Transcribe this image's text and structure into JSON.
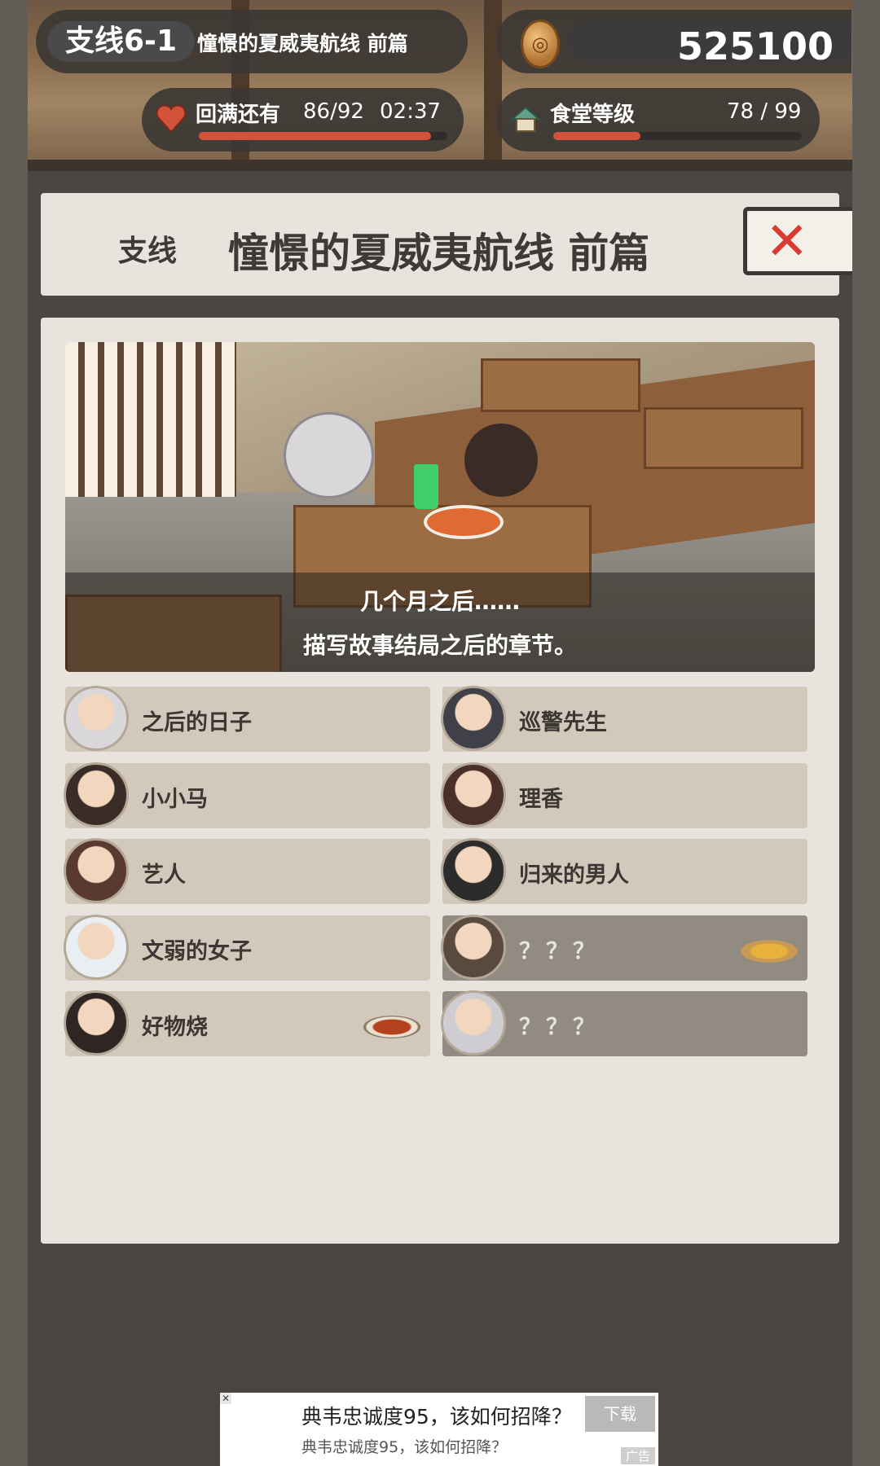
{
  "hud": {
    "chapter_tag": "支线6-1",
    "chapter_title": "憧憬的夏威夷航线 前篇",
    "coins": "525100",
    "stamina_label": "回满还有",
    "stamina_value": "86/92",
    "stamina_timer": "02:37",
    "stamina_fill": 0.935,
    "shop_label": "食堂等级",
    "shop_level": "78 / 99",
    "shop_fill": 0.35,
    "colors": {
      "bar": "#d2533a",
      "close": "#d73b32"
    }
  },
  "header": {
    "tag": "支线",
    "title": "憧憬的夏威夷航线 前篇",
    "close_icon": "close-icon"
  },
  "scene": {
    "caption_line1": "几个月之后……",
    "caption_line2": "描写故事结局之后的章节。"
  },
  "stories": [
    {
      "label": "之后的日子",
      "locked": false,
      "avatar": "granny-avatar"
    },
    {
      "label": "巡警先生",
      "locked": false,
      "avatar": "policeman-avatar"
    },
    {
      "label": "小小马",
      "locked": false,
      "avatar": "boy-avatar"
    },
    {
      "label": "理香",
      "locked": false,
      "avatar": "girl-avatar"
    },
    {
      "label": "艺人",
      "locked": false,
      "avatar": "performer-avatar"
    },
    {
      "label": "归来的男人",
      "locked": false,
      "avatar": "sunglasses-man-avatar"
    },
    {
      "label": "文弱的女子",
      "locked": false,
      "avatar": "hat-lady-avatar"
    },
    {
      "label": "？？？",
      "locked": true,
      "avatar": "old-man-avatar",
      "reward": "fried-food-icon"
    },
    {
      "label": "好物烧",
      "locked": false,
      "avatar": "woman-avatar",
      "reward": "okonomiyaki-icon"
    },
    {
      "label": "？？？",
      "locked": true,
      "avatar": "granny-avatar"
    }
  ],
  "ad": {
    "title": "典韦忠诚度95，该如何招降？",
    "subtitle": "典韦忠诚度95，该如何招降？",
    "button": "下载",
    "tag": "广告"
  }
}
